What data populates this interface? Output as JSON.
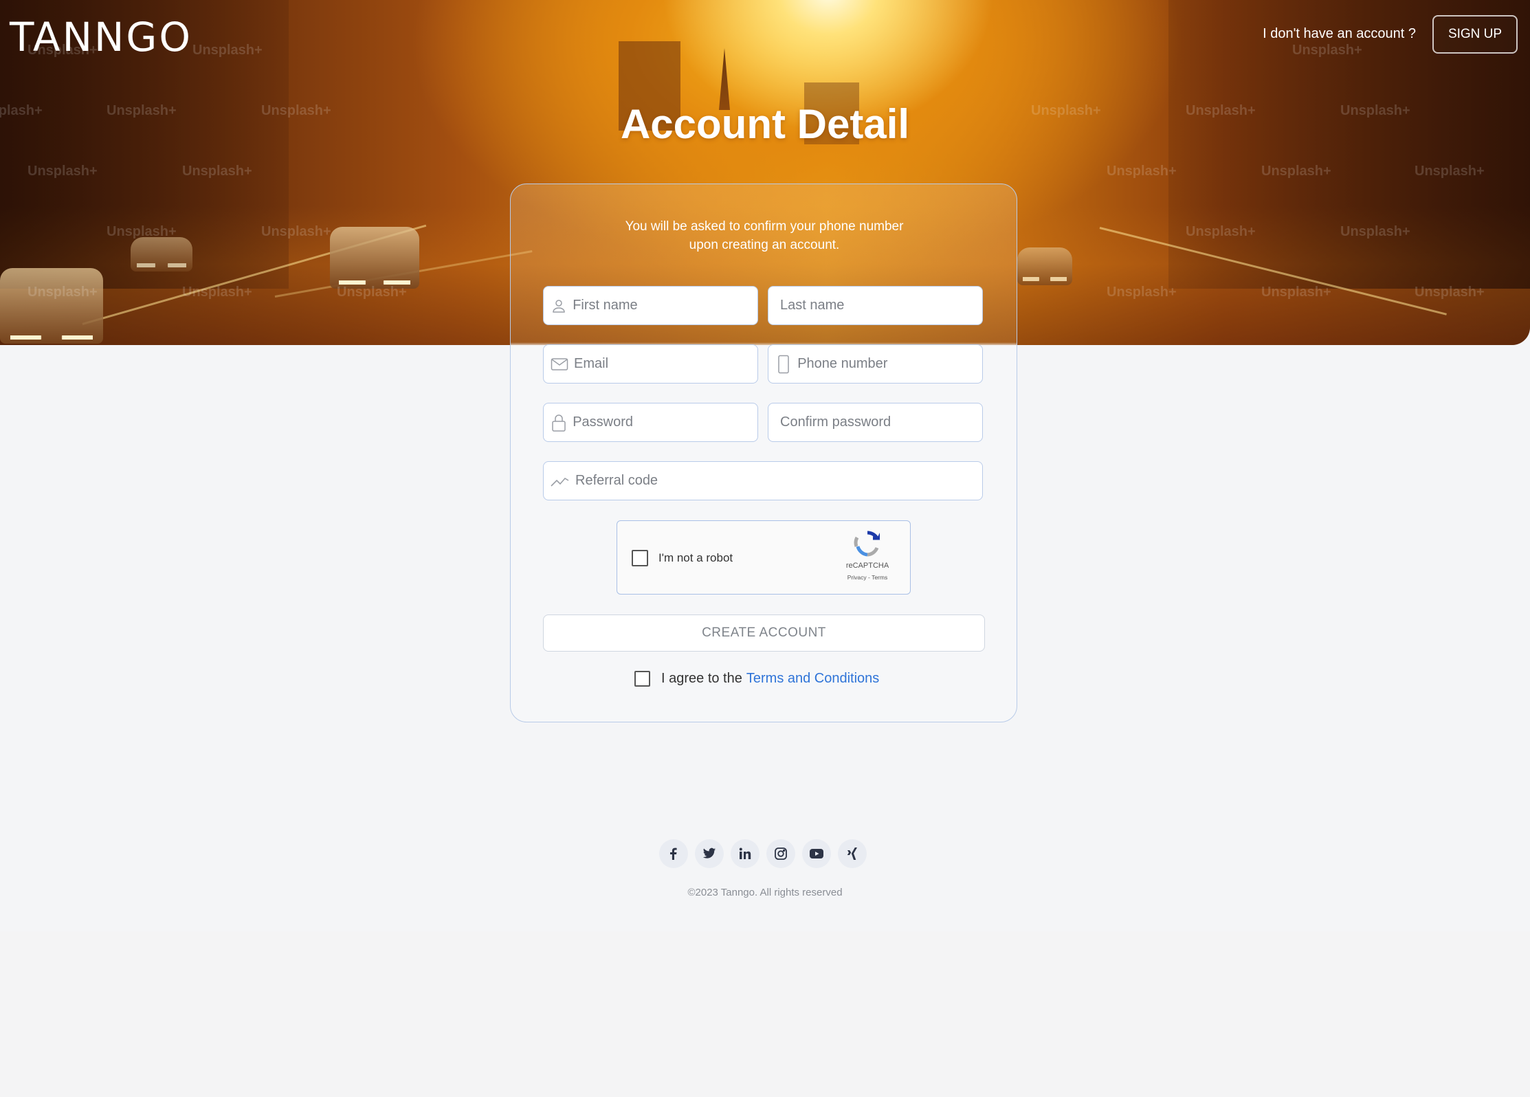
{
  "brand": {
    "logo_text": "TANNGO"
  },
  "header": {
    "question": "I don't have an account ?",
    "signup_label": "SIGN UP"
  },
  "page": {
    "title": "Account Detail"
  },
  "hero": {
    "watermark": "Unsplash+"
  },
  "form": {
    "notice_line1": "You will be asked to confirm your phone number",
    "notice_line2": "upon creating an account.",
    "first_name_placeholder": "First name",
    "last_name_placeholder": "Last name",
    "email_placeholder": "Email",
    "phone_placeholder": "Phone number",
    "password_placeholder": "Password",
    "confirm_password_placeholder": "Confirm password",
    "referral_placeholder": "Referral code",
    "captcha": {
      "label": "I'm not a robot",
      "brand": "reCAPTCHA",
      "links": "Privacy - Terms"
    },
    "create_label": "CREATE ACCOUNT",
    "agree_text": "I agree to the",
    "terms_link": "Terms and Conditions"
  },
  "footer": {
    "socials": [
      "facebook-icon",
      "twitter-icon",
      "linkedin-icon",
      "instagram-icon",
      "youtube-icon",
      "xing-icon"
    ],
    "copyright": "©2023 Tanngo. All rights reserved"
  },
  "colors": {
    "accent_link": "#2f74d8",
    "field_border": "#b9cbe9",
    "hero_orange": "#e89a17"
  }
}
